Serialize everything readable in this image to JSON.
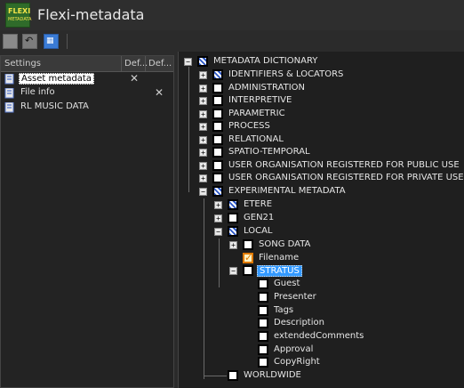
{
  "app": {
    "title": "Flexi-metadata",
    "logo_line1": "FLEXI",
    "logo_line2": "METADATA",
    "accent": "#2a56c6",
    "selection": "#3399ff"
  },
  "toolbar": {
    "buttons": [
      "stop-icon",
      "undo-icon",
      "grid-icon"
    ]
  },
  "left": {
    "columns": [
      "Settings",
      "Def...",
      "Def..."
    ],
    "rows": [
      {
        "label": "Asset metadata",
        "x1": "✕",
        "x2": ""
      },
      {
        "label": "File info",
        "x1": "",
        "x2": "✕"
      },
      {
        "label": "RL MUSIC DATA",
        "x1": "",
        "x2": ""
      }
    ]
  },
  "tree": {
    "root": "METADATA DICTIONARY",
    "items": {
      "ident": "IDENTIFIERS & LOCATORS",
      "admin": "ADMINISTRATION",
      "interp": "INTERPRETIVE",
      "param": "PARAMETRIC",
      "process": "PROCESS",
      "relational": "RELATIONAL",
      "spatio": "SPATIO-TEMPORAL",
      "uorg_public": "USER ORGANISATION REGISTERED FOR PUBLIC USE",
      "uorg_private": "USER ORGANISATION REGISTERED FOR PRIVATE USE",
      "experimental": "EXPERIMENTAL METADATA",
      "etere": "ETERE",
      "gen21": "GEN21",
      "local": "LOCAL",
      "song": "SONG DATA",
      "filename": "Filename",
      "stratus": "STRATUS",
      "guest": "Guest",
      "presenter": "Presenter",
      "tags": "Tags",
      "description": "Description",
      "extended": "extendedComments",
      "approval": "Approval",
      "copyright": "CopyRight",
      "worldwide": "WORLDWIDE"
    }
  }
}
